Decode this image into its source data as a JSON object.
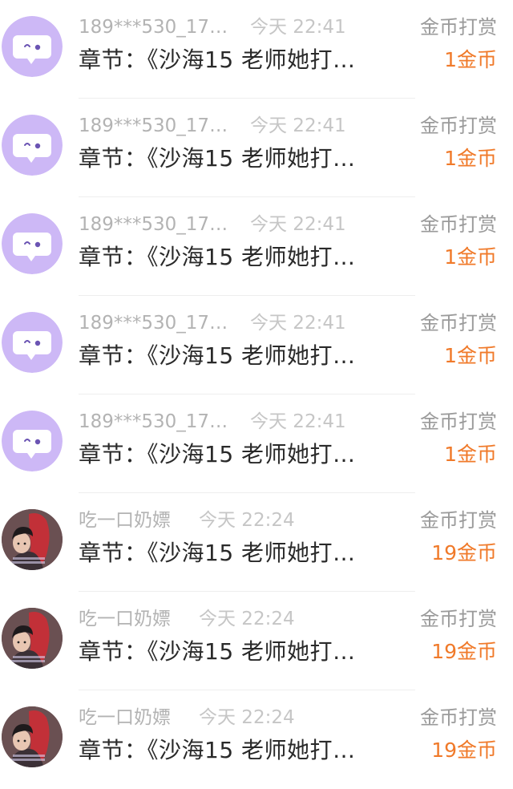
{
  "colors": {
    "accent": "#f07a2a",
    "muted": "#b3b3b3",
    "avatar_purple": "#cdb8f6"
  },
  "rewards": [
    {
      "avatar": "purple-chat-bubble-avatar",
      "name": "189***530_17…",
      "time": "今天 22:41",
      "chapter": "章节：《沙海15  老师她打…",
      "type": "金币打赏",
      "amount": "1金币"
    },
    {
      "avatar": "purple-chat-bubble-avatar",
      "name": "189***530_17…",
      "time": "今天 22:41",
      "chapter": "章节：《沙海15  老师她打…",
      "type": "金币打赏",
      "amount": "1金币"
    },
    {
      "avatar": "purple-chat-bubble-avatar",
      "name": "189***530_17…",
      "time": "今天 22:41",
      "chapter": "章节：《沙海15  老师她打…",
      "type": "金币打赏",
      "amount": "1金币"
    },
    {
      "avatar": "purple-chat-bubble-avatar",
      "name": "189***530_17…",
      "time": "今天 22:41",
      "chapter": "章节：《沙海15  老师她打…",
      "type": "金币打赏",
      "amount": "1金币"
    },
    {
      "avatar": "purple-chat-bubble-avatar",
      "name": "189***530_17…",
      "time": "今天 22:41",
      "chapter": "章节：《沙海15  老师她打…",
      "type": "金币打赏",
      "amount": "1金币"
    },
    {
      "avatar": "photo-avatar",
      "name": "吃一口奶嫖",
      "time": "今天 22:24",
      "chapter": "章节：《沙海15  老师她打…",
      "type": "金币打赏",
      "amount": "19金币"
    },
    {
      "avatar": "photo-avatar",
      "name": "吃一口奶嫖",
      "time": "今天 22:24",
      "chapter": "章节：《沙海15  老师她打…",
      "type": "金币打赏",
      "amount": "19金币"
    },
    {
      "avatar": "photo-avatar",
      "name": "吃一口奶嫖",
      "time": "今天 22:24",
      "chapter": "章节：《沙海15  老师她打…",
      "type": "金币打赏",
      "amount": "19金币"
    }
  ]
}
